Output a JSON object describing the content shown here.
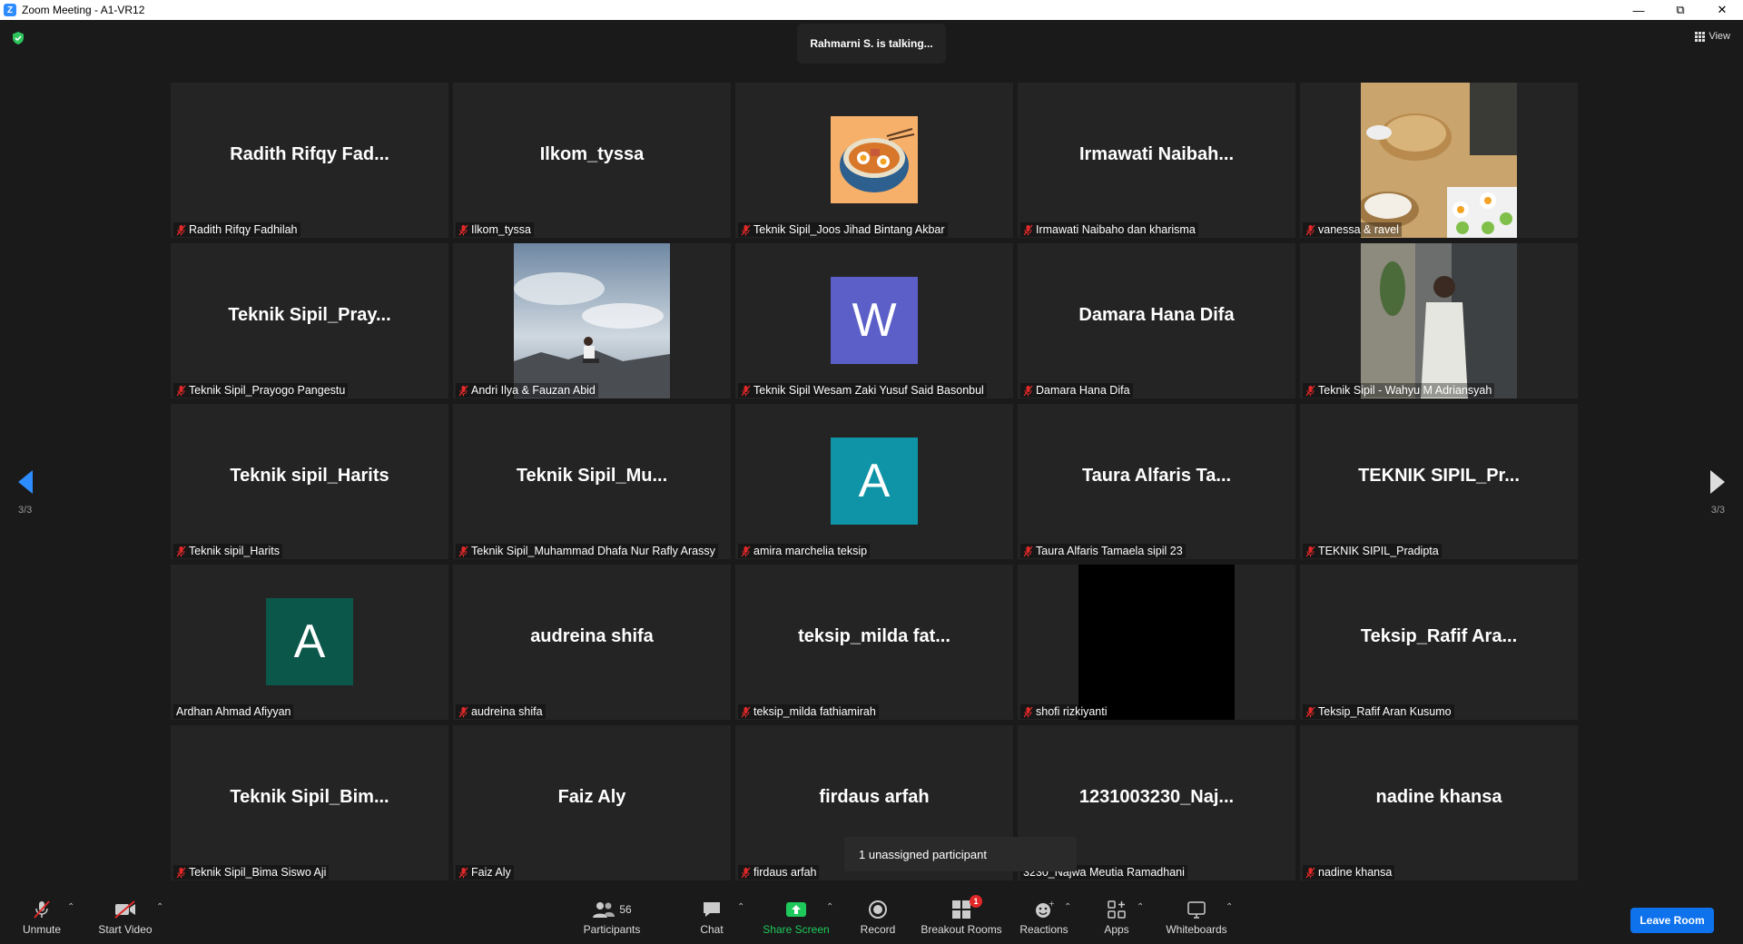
{
  "window": {
    "title": "Zoom Meeting - A1-VR12",
    "app_icon": "zoom-icon"
  },
  "header": {
    "talking": "Rahmarni S. is talking...",
    "view_label": "View"
  },
  "pagination": {
    "left": "3/3",
    "right": "3/3"
  },
  "tiles": [
    {
      "big": "Radith  Rifqy  Fad...",
      "label": "Radith Rifqy Fadhilah",
      "muted": true,
      "kind": "name"
    },
    {
      "big": "Ilkom_tyssa",
      "label": "Ilkom_tyssa",
      "muted": true,
      "kind": "name"
    },
    {
      "big": "",
      "label": "Teknik Sipil_Joos Jihad Bintang Akbar",
      "muted": true,
      "kind": "ramen"
    },
    {
      "big": "Irmawati  Naibah...",
      "label": "Irmawati Naibaho dan kharisma",
      "muted": true,
      "kind": "name"
    },
    {
      "big": "",
      "label": "vanessa & ravel",
      "muted": true,
      "kind": "cooking"
    },
    {
      "big": "Teknik  Sipil_Pray...",
      "label": "Teknik Sipil_Prayogo Pangestu",
      "muted": true,
      "kind": "name"
    },
    {
      "big": "",
      "label": "Andri Ilya & Fauzan Abid",
      "muted": true,
      "kind": "sky"
    },
    {
      "big": "W",
      "label": "Teknik Sipil Wesam Zaki Yusuf Said Basonbul",
      "muted": true,
      "kind": "letter",
      "color": "#5b5fc7"
    },
    {
      "big": "Damara Hana Difa",
      "label": "Damara Hana Difa",
      "muted": true,
      "kind": "name"
    },
    {
      "big": "",
      "label": "Teknik Sipil - Wahyu M Adriansyah",
      "muted": true,
      "kind": "person"
    },
    {
      "big": "Teknik sipil_Harits",
      "label": "Teknik sipil_Harits",
      "muted": true,
      "kind": "name"
    },
    {
      "big": "Teknik  Sipil_Mu...",
      "label": "Teknik Sipil_Muhammad Dhafa Nur Rafly Arassy",
      "muted": true,
      "kind": "name"
    },
    {
      "big": "A",
      "label": "amira marchelia teksip",
      "muted": true,
      "kind": "letter",
      "color": "#0e94a6"
    },
    {
      "big": "Taura  Alfaris  Ta...",
      "label": "Taura Alfaris Tamaela sipil 23",
      "muted": true,
      "kind": "name"
    },
    {
      "big": "TEKNIK  SIPIL_Pr...",
      "label": "TEKNIK SIPIL_Pradipta",
      "muted": true,
      "kind": "name"
    },
    {
      "big": "A",
      "label": "Ardhan Ahmad Afiyyan",
      "muted": false,
      "kind": "letter",
      "color": "#0b5749"
    },
    {
      "big": "audreina shifa",
      "label": "audreina shifa",
      "muted": true,
      "kind": "name"
    },
    {
      "big": "teksip_milda  fat...",
      "label": "teksip_milda fathiamirah",
      "muted": true,
      "kind": "name"
    },
    {
      "big": "",
      "label": "shofi rizkiyanti",
      "muted": true,
      "kind": "black"
    },
    {
      "big": "Teksip_Rafif  Ara...",
      "label": "Teksip_Rafif Aran Kusumo",
      "muted": true,
      "kind": "name"
    },
    {
      "big": "Teknik  Sipil_Bim...",
      "label": "Teknik Sipil_Bima Siswo Aji",
      "muted": true,
      "kind": "name"
    },
    {
      "big": "Faiz Aly",
      "label": "Faiz Aly",
      "muted": true,
      "kind": "name"
    },
    {
      "big": "firdaus arfah",
      "label": "firdaus arfah",
      "muted": true,
      "kind": "name"
    },
    {
      "big": "1231003230_Naj...",
      "label": "3230_Najwa Meutia Ramadhani",
      "muted": false,
      "kind": "name"
    },
    {
      "big": "nadine khansa",
      "label": "nadine khansa",
      "muted": true,
      "kind": "name"
    }
  ],
  "tooltip": "1 unassigned participant",
  "toolbar": {
    "unmute": "Unmute",
    "start_video": "Start Video",
    "participants": "Participants",
    "participants_count": "56",
    "chat": "Chat",
    "share_screen": "Share Screen",
    "record": "Record",
    "breakout_rooms": "Breakout Rooms",
    "breakout_badge": "1",
    "reactions": "Reactions",
    "apps": "Apps",
    "whiteboards": "Whiteboards",
    "leave_room": "Leave Room"
  },
  "colors": {
    "accent": "#0e72ed",
    "share": "#1ec95b",
    "alert": "#e02828"
  }
}
